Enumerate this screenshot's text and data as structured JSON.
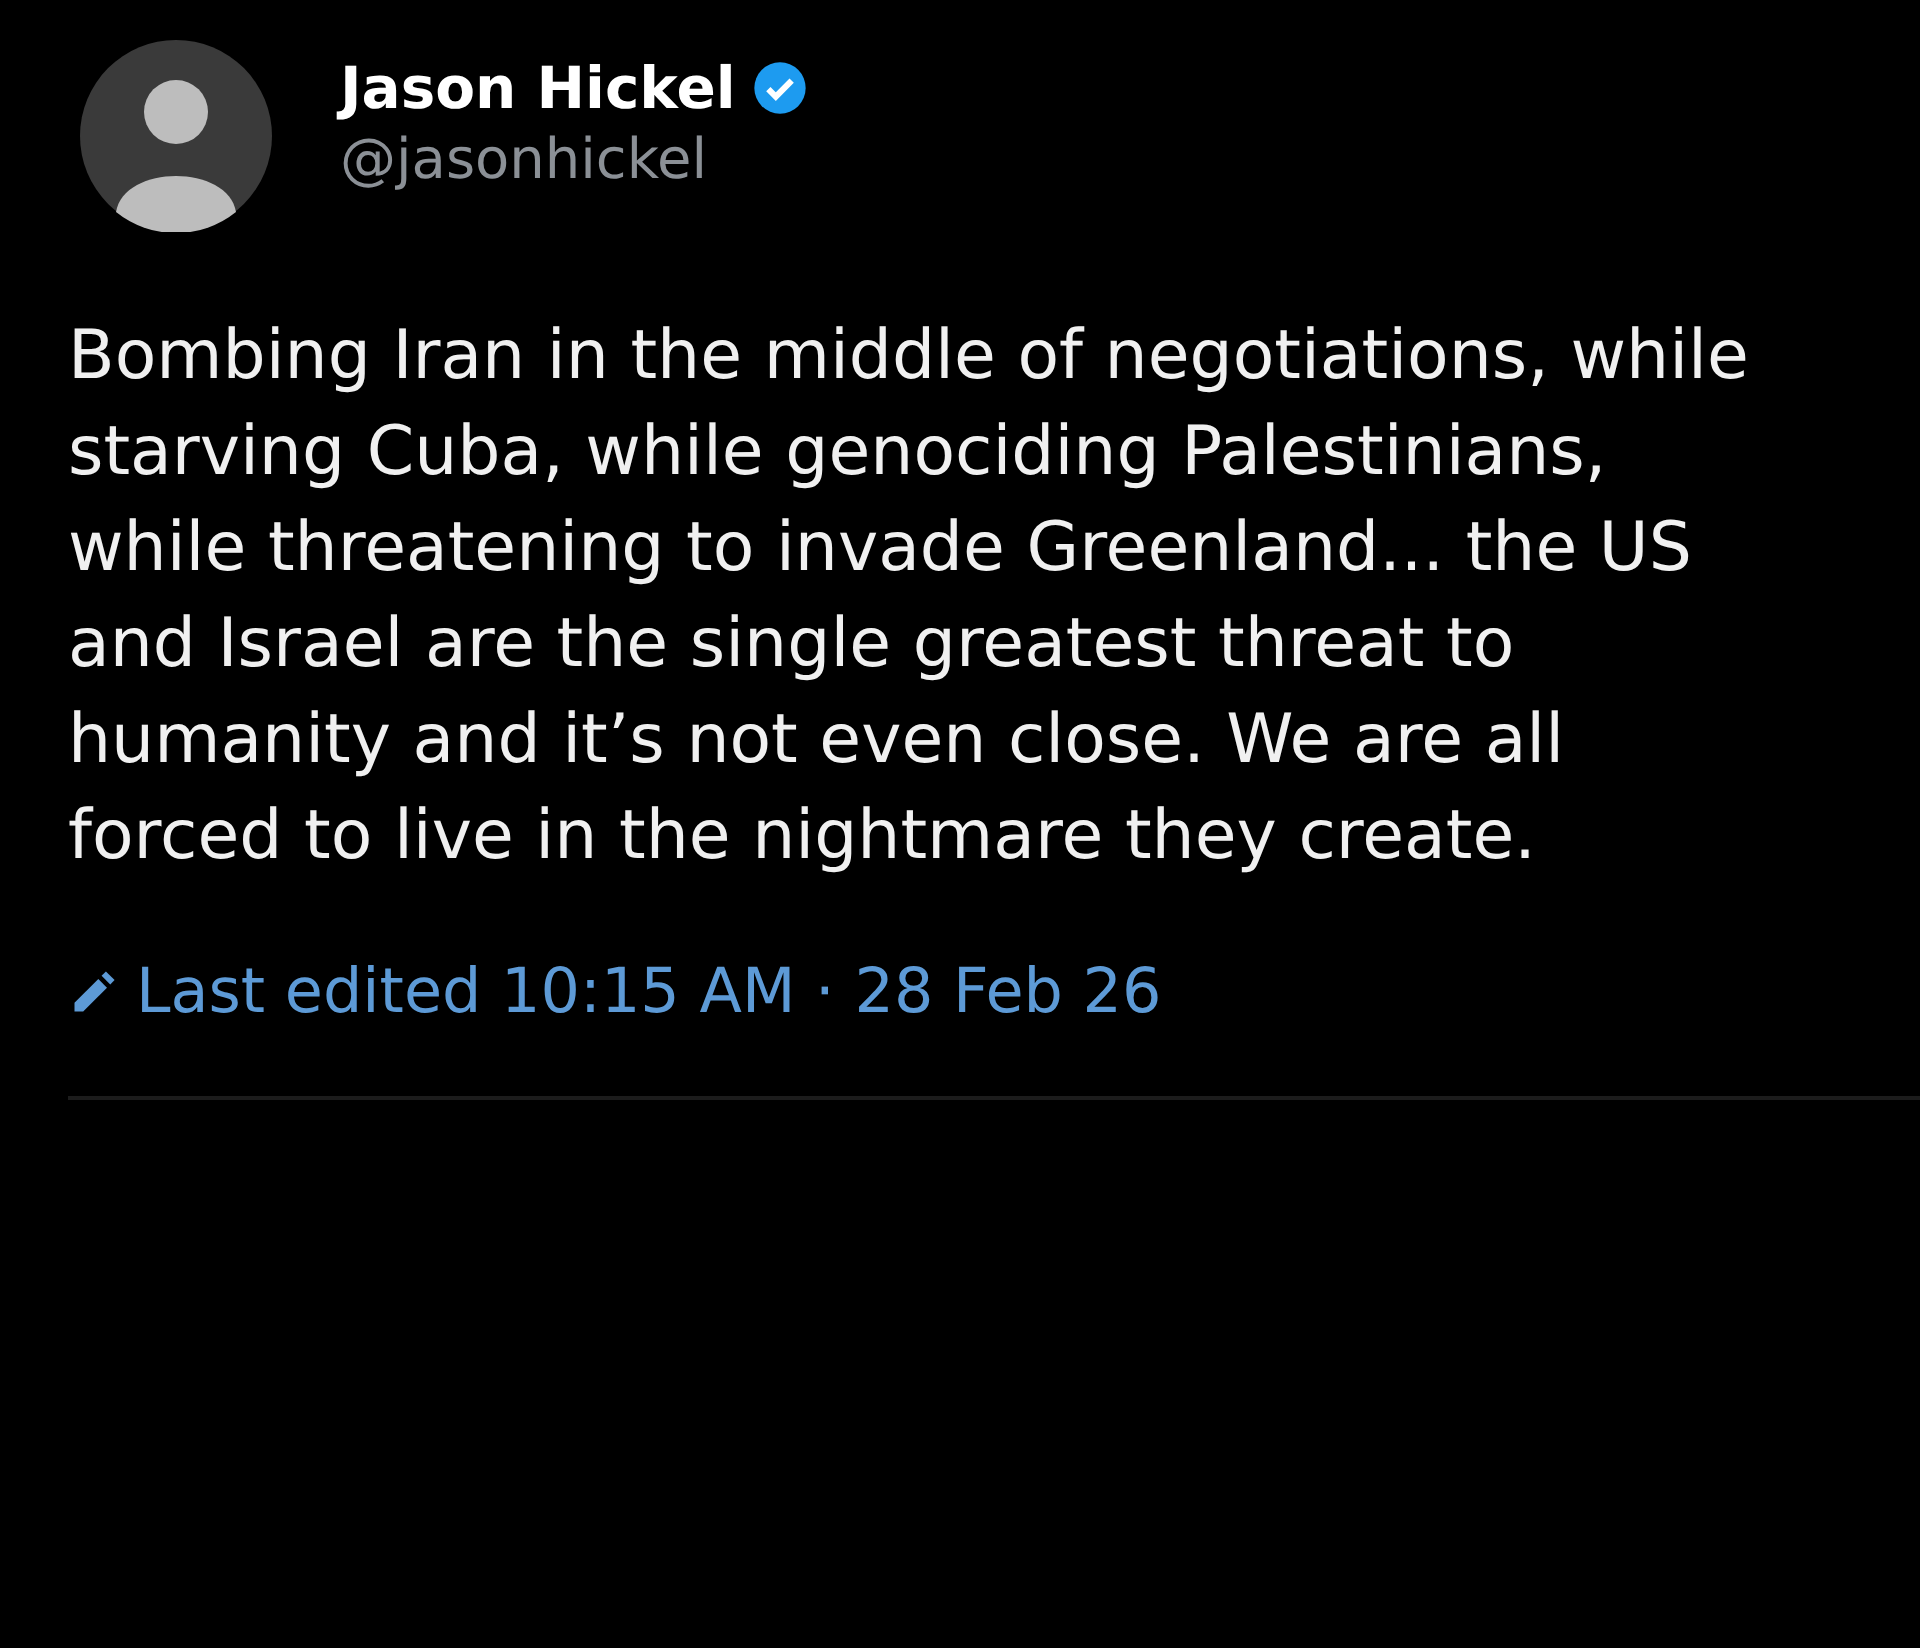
{
  "author": {
    "name": "Jason Hickel",
    "handle": "@jasonhickel",
    "verified": true
  },
  "post": {
    "text": "Bombing Iran in the middle of negotiations, while starving Cuba, while genociding Palestinians, while threatening to invade Greenland... the US and Israel are the single greatest threat to humanity and it’s not even close. We are all forced to live in the nightmare they create."
  },
  "edited": {
    "label": "Last edited",
    "time": "10:15 AM",
    "separator": "·",
    "date": "28 Feb 26"
  }
}
